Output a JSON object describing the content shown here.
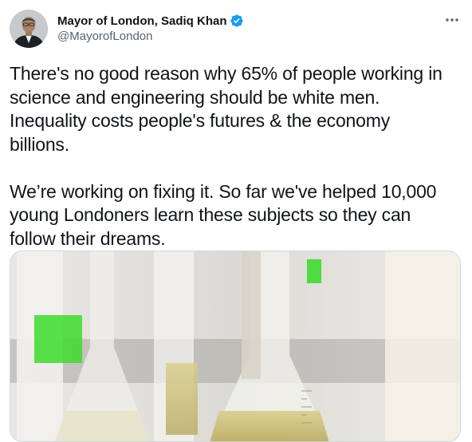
{
  "author": {
    "display_name": "Mayor of London, Sadiq Khan",
    "handle": "@MayorofLondon",
    "verified": true
  },
  "tweet": {
    "text": "There's no good reason why 65% of people working in\nscience and engineering should be white men.\nInequality costs people's futures & the economy\nbillions.\n\nWe’re working on fixing it. So far we've helped 10,000\nyoung Londoners learn these subjects so they can\nfollow their dreams."
  },
  "icons": {
    "verified": "verified-badge-icon",
    "more": "more-options-icon"
  },
  "colors": {
    "verified_blue": "#1d9bf0",
    "handle_gray": "#536471",
    "text": "#0f1419",
    "accent_green": "#3ddc2c"
  }
}
